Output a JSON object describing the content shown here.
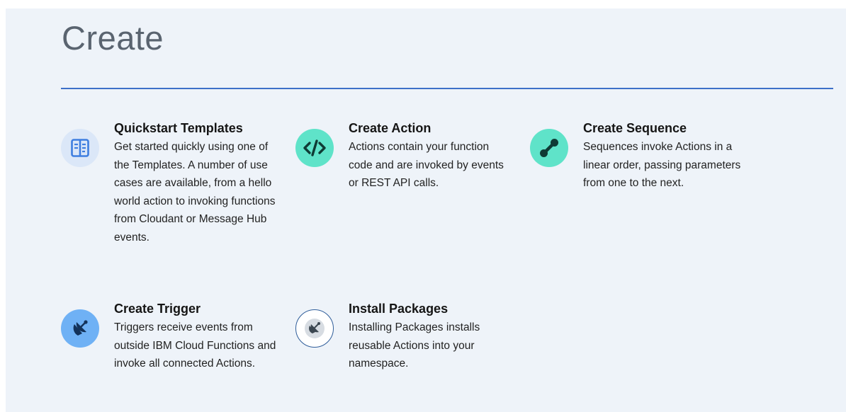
{
  "page": {
    "title": "Create"
  },
  "cards": [
    {
      "title": "Quickstart Templates",
      "description": "Get started quickly using one of the Templates. A number of use cases are available, from a hello world action to invoking functions from Cloudant or Message Hub events.",
      "icon": "templates-icon",
      "icon_bg": "#dbe7f8",
      "icon_color": "#3e7ee0"
    },
    {
      "title": "Create Action",
      "description": "Actions contain your function code and are invoked by events or REST API calls.",
      "icon": "code-icon",
      "icon_bg": "#5fe3c9",
      "icon_color": "#0f3b35"
    },
    {
      "title": "Create Sequence",
      "description": "Sequences invoke Actions in a linear order, passing parameters from one to the next.",
      "icon": "sequence-icon",
      "icon_bg": "#5fe3c9",
      "icon_color": "#0f3b35"
    },
    {
      "title": "Create Trigger",
      "description": "Triggers receive events from outside IBM Cloud Functions and invoke all connected Actions.",
      "icon": "satellite-dish-icon",
      "icon_bg": "#6fb1f5",
      "icon_color": "#13325a"
    },
    {
      "title": "Install Packages",
      "description": "Installing Packages installs reusable Actions into your namespace.",
      "icon": "package-icon",
      "icon_bg": "#ffffff",
      "icon_color": "#2f5d9a"
    }
  ],
  "colors": {
    "panel_bg": "#eef3f9",
    "accent_rule": "#3d70c8",
    "title_text": "#5a6470"
  }
}
